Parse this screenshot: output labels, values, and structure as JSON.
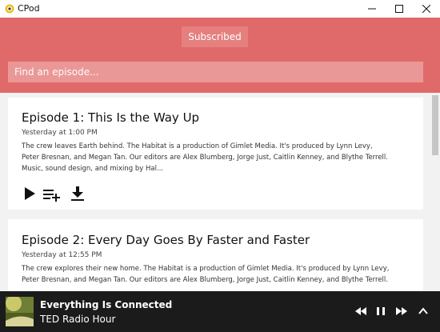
{
  "window": {
    "title": "CPod"
  },
  "header": {
    "subscribed_label": "Subscribed",
    "search": {
      "placeholder": "Find an episode...",
      "value": ""
    }
  },
  "episodes": [
    {
      "title": "Episode 1: This Is the Way Up",
      "date": "Yesterday at 1:00 PM",
      "desc_lines": [
        "The crew leaves Earth behind. The Habitat is a production of Gimlet Media. It's produced by Lynn Levy,",
        "Peter Bresnan, and Megan Tan. Our editors are Alex Blumberg, Jorge Just, Caitlin Kenney, and Blythe Terrell.",
        "Music, sound design, and mixing by Hal..."
      ],
      "actions": {
        "icons": [
          "play-icon",
          "add-to-queue-icon",
          "download-icon"
        ]
      }
    },
    {
      "title": "Episode 2: Every Day Goes By Faster and Faster",
      "date": "Yesterday at 12:55 PM",
      "desc_lines": [
        "The crew explores their new home. The Habitat is a production of Gimlet Media. It's produced by Lynn Levy,",
        "Peter Bresnan, and Megan Tan. Our editors are Alex Blumberg, Jorge Just, Caitlin Kenney, and Blythe Terrell."
      ]
    }
  ],
  "player": {
    "title": "Everything Is Connected",
    "show": "TED Radio Hour",
    "controls": [
      "rewind-icon",
      "pause-icon",
      "fast-forward-icon",
      "expand-up-icon"
    ]
  },
  "colors": {
    "header": "#e06a69",
    "accent": "#e06a69",
    "player_bg": "#1b1b1b"
  }
}
